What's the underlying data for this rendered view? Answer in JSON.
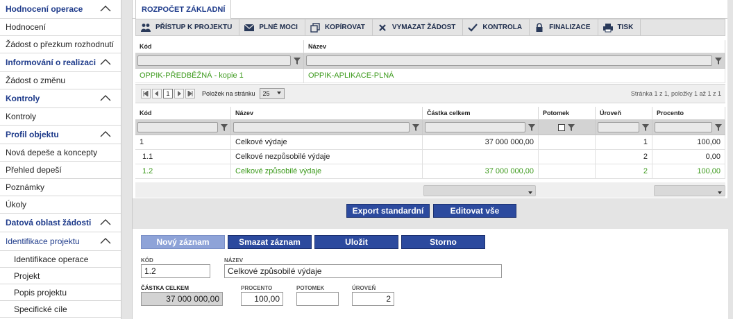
{
  "sidebar": {
    "sections": [
      {
        "title": "Hodnocení operace",
        "items": [
          "Hodnocení",
          "Žádost o přezkum rozhodnutí"
        ]
      },
      {
        "title": "Informování o realizaci",
        "items": [
          "Žádost o změnu"
        ]
      },
      {
        "title": "Kontroly",
        "items": [
          "Kontroly"
        ]
      },
      {
        "title": "Profil objektu",
        "items": [
          "Nová depeše a koncepty",
          "Přehled depeší",
          "Poznámky",
          "Úkoly"
        ]
      },
      {
        "title": "Datová oblast žádosti",
        "items": []
      }
    ],
    "active_section": "Identifikace projektu",
    "sub_items": [
      "Identifikace operace",
      "Projekt",
      "Popis projektu",
      "Specifické cíle"
    ]
  },
  "tab": {
    "label": "ROZPOČET ZÁKLADNÍ"
  },
  "toolbar": {
    "buttons": [
      {
        "label": "PŘÍSTUP K PROJEKTU",
        "icon": "users-icon"
      },
      {
        "label": "PLNÉ MOCI",
        "icon": "envelope-icon"
      },
      {
        "label": "KOPÍROVAT",
        "icon": "copy-icon"
      },
      {
        "label": "VYMAZAT ŽÁDOST",
        "icon": "x-icon"
      },
      {
        "label": "KONTROLA",
        "icon": "check-icon"
      },
      {
        "label": "FINALIZACE",
        "icon": "lock-icon"
      },
      {
        "label": "TISK",
        "icon": "printer-icon"
      }
    ]
  },
  "grid1": {
    "headers": [
      "Kód",
      "Název"
    ],
    "rows": [
      [
        "OPPIK-PŘEDBĚŽNÁ - kopie 1",
        "OPPIK-APLIKACE-PLNÁ"
      ]
    ]
  },
  "pager": {
    "current_page": "1",
    "page_size_label": "Položek na stránku",
    "page_size": "25",
    "info": "Stránka 1 z 1, položky 1 až 1 z 1"
  },
  "grid2": {
    "headers": [
      "Kód",
      "Název",
      "Částka celkem",
      "Potomek",
      "Úroveň",
      "Procento"
    ],
    "rows": [
      {
        "kod": "1",
        "nazev": "Celkové výdaje",
        "castka": "37 000 000,00",
        "potomek": "",
        "uroven": "1",
        "procento": "100,00",
        "green": false
      },
      {
        "kod": "1.1",
        "nazev": "Celkové nezpůsobilé výdaje",
        "castka": "",
        "potomek": "",
        "uroven": "2",
        "procento": "0,00",
        "green": false
      },
      {
        "kod": "1.2",
        "nazev": "Celkové způsobilé výdaje",
        "castka": "37 000 000,00",
        "potomek": "",
        "uroven": "2",
        "procento": "100,00",
        "green": true
      }
    ]
  },
  "actions": {
    "export": "Export standardní",
    "edit_all": "Editovat vše",
    "new_record": "Nový záznam",
    "delete_record": "Smazat záznam",
    "save": "Uložit",
    "cancel": "Storno"
  },
  "form": {
    "kod_label": "KÓD",
    "kod_value": "1.2",
    "nazev_label": "NÁZEV",
    "nazev_value": "Celkové způsobilé výdaje",
    "castka_label": "ČÁSTKA CELKEM",
    "castka_value": "37 000 000,00",
    "procento_label": "PROCENTO",
    "procento_value": "100,00",
    "potomek_label": "POTOMEK",
    "potomek_value": "",
    "uroven_label": "ÚROVEŇ",
    "uroven_value": "2"
  },
  "colors": {
    "accent": "#1d3a8a",
    "button": "#2c4a9e",
    "button_disabled": "#8ea3d8",
    "green_text": "#3c9a1c"
  }
}
